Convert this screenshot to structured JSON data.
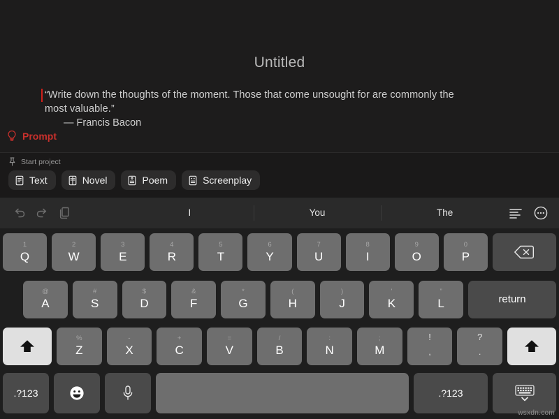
{
  "editor": {
    "title": "Untitled",
    "body_line1": "“Write down the thoughts of the moment. Those that come unsought for are commonly the",
    "body_line2": "most valuable.”",
    "attribution": "— Francis Bacon",
    "prompt_label": "Prompt",
    "prompt_icon": "lightbulb-icon",
    "caret_color": "#d0201a",
    "prompt_color": "#c9302c"
  },
  "project_bar": {
    "start_label": "Start project",
    "start_icon": "pin-icon",
    "chips": [
      {
        "label": "Text",
        "icon": "document-text-icon"
      },
      {
        "label": "Novel",
        "icon": "document-book-icon"
      },
      {
        "label": "Poem",
        "icon": "document-poem-icon"
      },
      {
        "label": "Screenplay",
        "icon": "document-screenplay-icon"
      }
    ]
  },
  "suggestion_bar": {
    "left_icons": [
      {
        "name": "undo-icon"
      },
      {
        "name": "redo-icon"
      },
      {
        "name": "paste-icon"
      }
    ],
    "suggestions": [
      "I",
      "You",
      "The"
    ],
    "right_icons": [
      {
        "name": "text-format-icon"
      },
      {
        "name": "more-circle-icon"
      }
    ]
  },
  "keyboard": {
    "row1": [
      {
        "alt": "1",
        "main": "Q"
      },
      {
        "alt": "2",
        "main": "W"
      },
      {
        "alt": "3",
        "main": "E"
      },
      {
        "alt": "4",
        "main": "R"
      },
      {
        "alt": "5",
        "main": "T"
      },
      {
        "alt": "6",
        "main": "Y"
      },
      {
        "alt": "7",
        "main": "U"
      },
      {
        "alt": "8",
        "main": "I"
      },
      {
        "alt": "9",
        "main": "O"
      },
      {
        "alt": "0",
        "main": "P"
      }
    ],
    "backspace_icon": "backspace-icon",
    "row2": [
      {
        "alt": "@",
        "main": "A"
      },
      {
        "alt": "#",
        "main": "S"
      },
      {
        "alt": "$",
        "main": "D"
      },
      {
        "alt": "&",
        "main": "F"
      },
      {
        "alt": "*",
        "main": "G"
      },
      {
        "alt": "(",
        "main": "H"
      },
      {
        "alt": ")",
        "main": "J"
      },
      {
        "alt": "'",
        "main": "K"
      },
      {
        "alt": "”",
        "main": "L"
      }
    ],
    "return_label": "return",
    "row3": [
      {
        "alt": "%",
        "main": "Z"
      },
      {
        "alt": "-",
        "main": "X"
      },
      {
        "alt": "+",
        "main": "C"
      },
      {
        "alt": "=",
        "main": "V"
      },
      {
        "alt": "/",
        "main": "B"
      },
      {
        "alt": ":",
        "main": "N"
      },
      {
        "alt": ";",
        "main": "M"
      }
    ],
    "punct_keys": [
      {
        "alt": "!",
        "main": ","
      },
      {
        "alt": "?",
        "main": "."
      }
    ],
    "shift_left_icon": "shift-icon",
    "shift_right_icon": "shift-icon",
    "shift_active": true,
    "row4": {
      "mode_left_label": ".?123",
      "emoji_icon": "emoji-icon",
      "mic_icon": "microphone-icon",
      "space_label": "",
      "mode_right_label": ".?123",
      "dismiss_icon": "keyboard-dismiss-icon"
    }
  },
  "watermark": {
    "text": "wsxdn.com"
  }
}
